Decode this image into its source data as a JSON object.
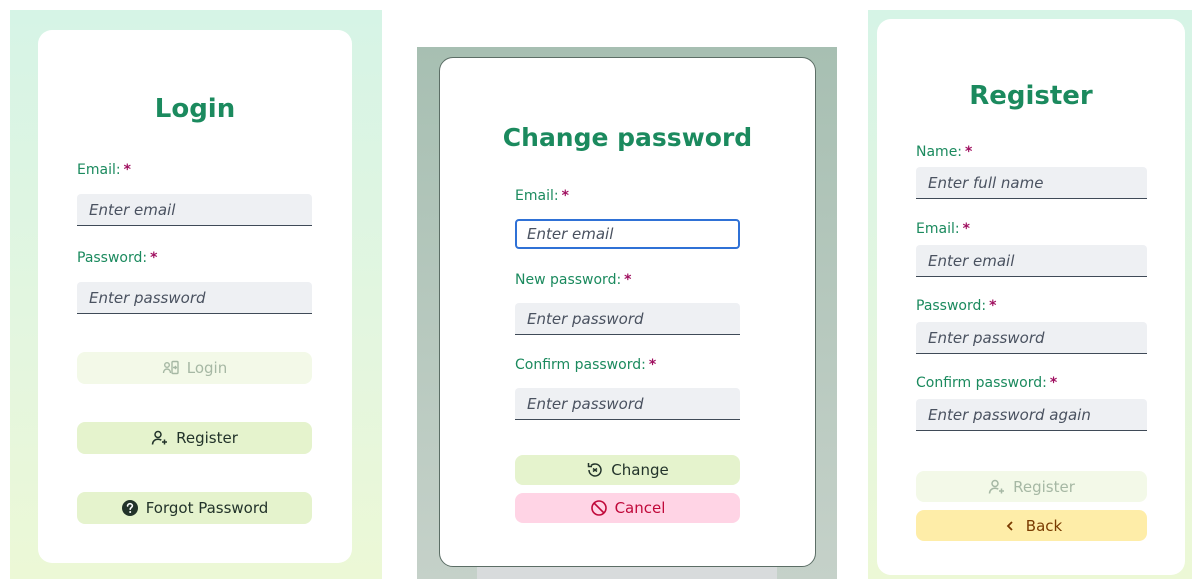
{
  "login": {
    "title": "Login",
    "email_label": "Email:",
    "email_placeholder": "Enter email",
    "password_label": "Password:",
    "password_placeholder": "Enter password",
    "login_button": "Login",
    "register_button": "Register",
    "forgot_button": "Forgot Password",
    "required_mark": "*"
  },
  "change_password": {
    "title": "Change password",
    "email_label": "Email:",
    "email_placeholder": "Enter email",
    "new_password_label": "New password:",
    "new_password_placeholder": "Enter password",
    "confirm_label": "Confirm password:",
    "confirm_placeholder": "Enter password",
    "change_button": "Change",
    "cancel_button": "Cancel",
    "required_mark": "*"
  },
  "register": {
    "title": "Register",
    "name_label": "Name:",
    "name_placeholder": "Enter full name",
    "email_label": "Email:",
    "email_placeholder": "Enter email",
    "password_label": "Password:",
    "password_placeholder": "Enter password",
    "confirm_label": "Confirm password:",
    "confirm_placeholder": "Enter password again",
    "register_button": "Register",
    "back_button": "Back",
    "required_mark": "*"
  },
  "colors": {
    "accent_green": "#1b8a5e",
    "required_magenta": "#a01060",
    "focus_blue": "#2f71d6",
    "button_green": "#e5f3cd",
    "button_pink": "#ffd4e5",
    "button_yellow": "#feeda8"
  },
  "icons": {
    "login_icon": "login-icon",
    "register_icon": "add-user-icon",
    "forgot_icon": "question-circle-icon",
    "change_icon": "refresh-icon",
    "cancel_icon": "cancel-circle-icon",
    "back_icon": "chevron-left-icon"
  }
}
